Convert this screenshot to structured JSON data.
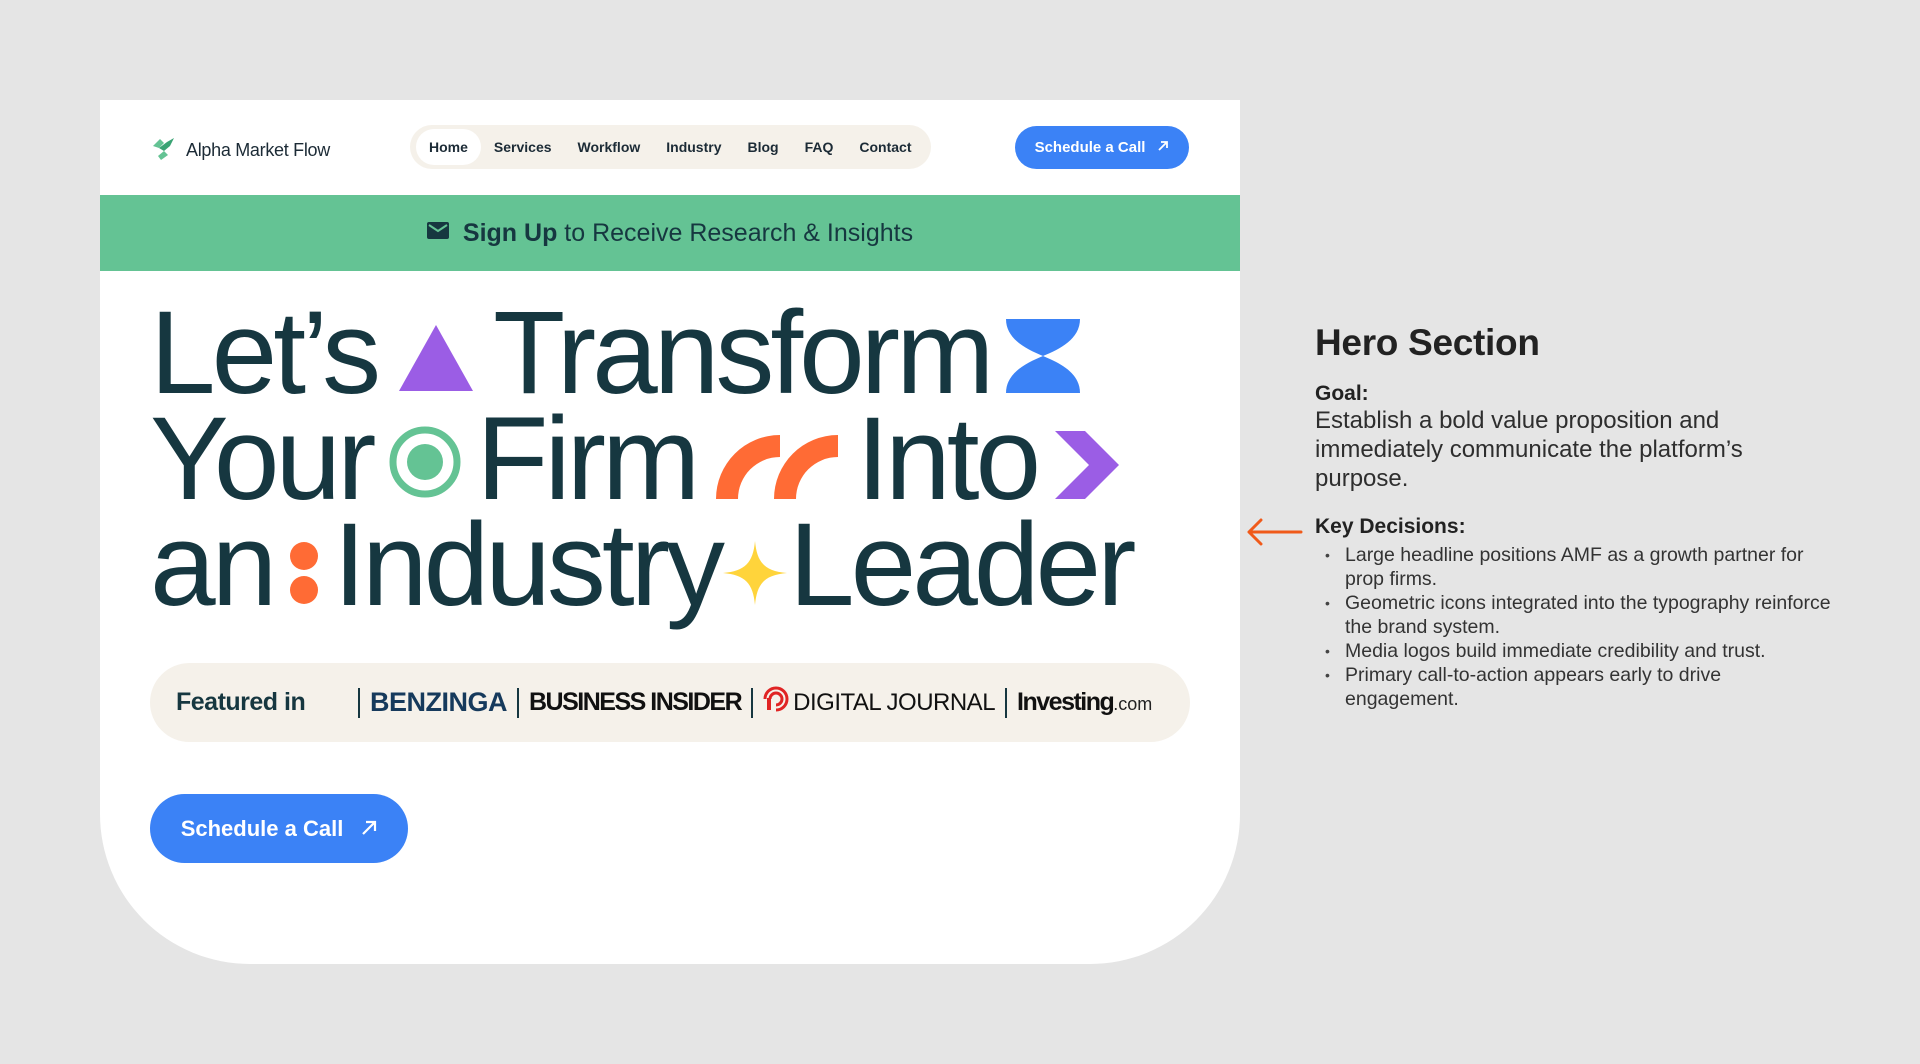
{
  "nav": {
    "logo_text": "Alpha Market Flow",
    "menu": [
      "Home",
      "Services",
      "Workflow",
      "Industry",
      "Blog",
      "FAQ",
      "Contact"
    ],
    "active_index": 0,
    "cta_label": "Schedule a Call"
  },
  "banner": {
    "bold": "Sign Up",
    "rest": " to Receive Research & Insights"
  },
  "headline": {
    "line1": [
      "Let’s",
      "Transform"
    ],
    "line2": [
      "Your",
      "Firm",
      "Into"
    ],
    "line3": [
      "an",
      "Industry",
      "Leader"
    ]
  },
  "featured": {
    "label": "Featured in",
    "benzinga": "BENZINGA",
    "business_insider": "BUSINESS INSIDER",
    "digital_journal": "DIGITAL JOURNAL",
    "investing": "Investing",
    "investing_suffix": ".com"
  },
  "main_cta_label": "Schedule a Call",
  "annotation": {
    "title": "Hero Section",
    "goal_heading": "Goal:",
    "goal_text": "Establish a bold value proposition and immediately communicate the platform’s purpose.",
    "decisions_heading": "Key Decisions:",
    "decisions": [
      "Large headline positions AMF as a growth partner for prop firms.",
      "Geometric icons integrated into the typography reinforce the brand system.",
      "Media logos build immediate credibility and trust.",
      "Primary call-to-action appears early to drive engagement."
    ]
  },
  "colors": {
    "page_bg": "#e5e5e5",
    "brand_dark": "#163740",
    "brand_green": "#64c394",
    "cta_blue": "#3b82f6",
    "accent_purple": "#9b5de5",
    "accent_orange": "#ff6b35",
    "accent_yellow": "#ffd43b",
    "arrow_orange": "#f05a1a"
  },
  "icons": [
    "logo-mark-icon",
    "mail-icon",
    "arrow-up-right-icon",
    "triangle-icon",
    "hourglass-icon",
    "target-circle-icon",
    "quarter-arcs-icon",
    "chevron-right-icon",
    "two-dots-icon",
    "sparkle-icon",
    "digital-journal-logo-icon",
    "arrow-left-icon"
  ]
}
